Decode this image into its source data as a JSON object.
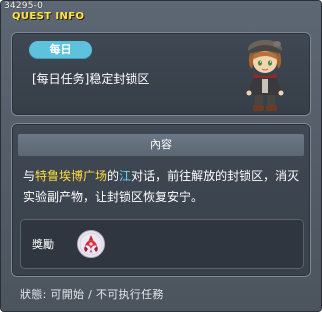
{
  "window": {
    "quest_id": "34295-0",
    "title": "QUEST INFO"
  },
  "quest": {
    "badge": "每日",
    "name": "[每日任务]稳定封锁区",
    "npc_icon": "npc-portrait-icon"
  },
  "content": {
    "header": "內容",
    "description": {
      "part1": "与",
      "place": "特鲁埃博广场",
      "part2": "的",
      "npc": "江",
      "part3": "对话，前往解放的封锁区，消灭实验副产物，让封锁区恢复安宁。"
    }
  },
  "reward": {
    "label": "獎勵",
    "icon": "reward-emblem-icon"
  },
  "status": {
    "text": "狀態: 可開始 / 不可执行任務"
  },
  "colors": {
    "title": "#ffe24a",
    "badge": "#5ec2dd",
    "highlight_place": "#ffdc3a",
    "highlight_npc": "#68d8ff"
  }
}
